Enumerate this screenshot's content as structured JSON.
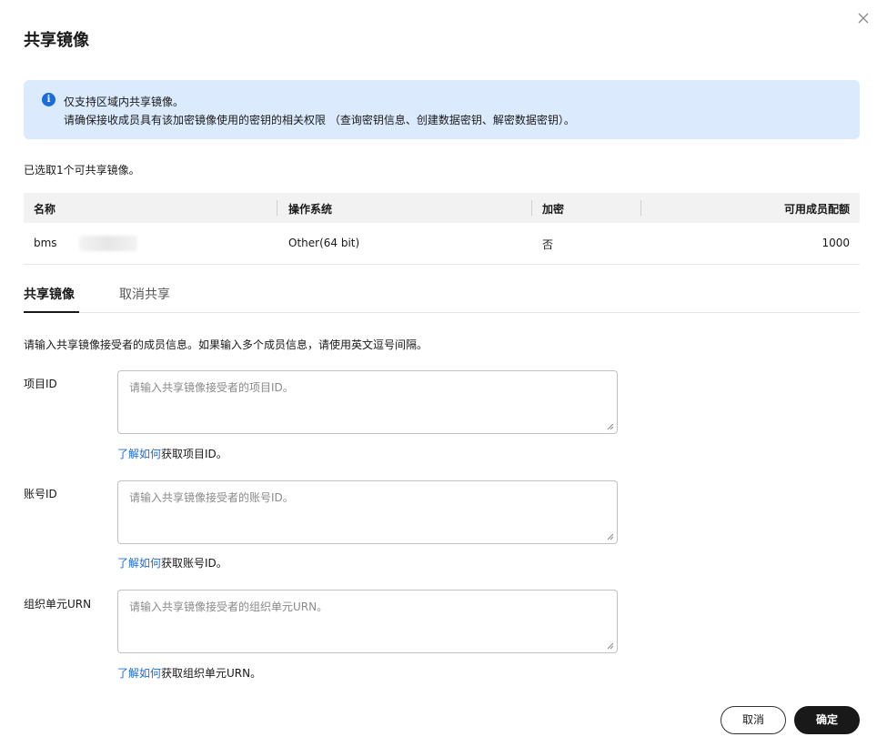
{
  "dialog": {
    "title": "共享镜像",
    "close_icon": "close-icon"
  },
  "notice": {
    "icon": "info-icon",
    "icon_glyph": "i",
    "line1": "仅支持区域内共享镜像。",
    "line2": "请确保接收成员具有该加密镜像使用的密钥的相关权限 （查询密钥信息、创建数据密钥、解密数据密钥）。"
  },
  "selected_count_text": "已选取1个可共享镜像。",
  "table": {
    "columns": [
      "名称",
      "操作系统",
      "加密",
      "可用成员配额"
    ],
    "rows": [
      {
        "name": "bms",
        "os": "Other(64 bit)",
        "encrypted": "否",
        "quota": "1000"
      }
    ]
  },
  "tabs": [
    {
      "label": "共享镜像",
      "active": true
    },
    {
      "label": "取消共享",
      "active": false
    }
  ],
  "instruction": "请输入共享镜像接受者的成员信息。如果输入多个成员信息，请使用英文逗号间隔。",
  "fields": [
    {
      "label": "项目ID",
      "placeholder": "请输入共享镜像接受者的项目ID。",
      "value": "",
      "help_link": "了解如何",
      "help_text": "获取项目ID。"
    },
    {
      "label": "账号ID",
      "placeholder": "请输入共享镜像接受者的账号ID。",
      "value": "",
      "help_link": "了解如何",
      "help_text": "获取账号ID。"
    },
    {
      "label": "组织单元URN",
      "placeholder": "请输入共享镜像接受者的组织单元URN。",
      "value": "",
      "help_link": "了解如何",
      "help_text": "获取组织单元URN。"
    }
  ],
  "buttons": {
    "cancel": "取消",
    "ok": "确定"
  },
  "colors": {
    "accent_link": "#1a6cdb",
    "notice_bg": "#dbeafd",
    "primary_button": "#191919"
  }
}
